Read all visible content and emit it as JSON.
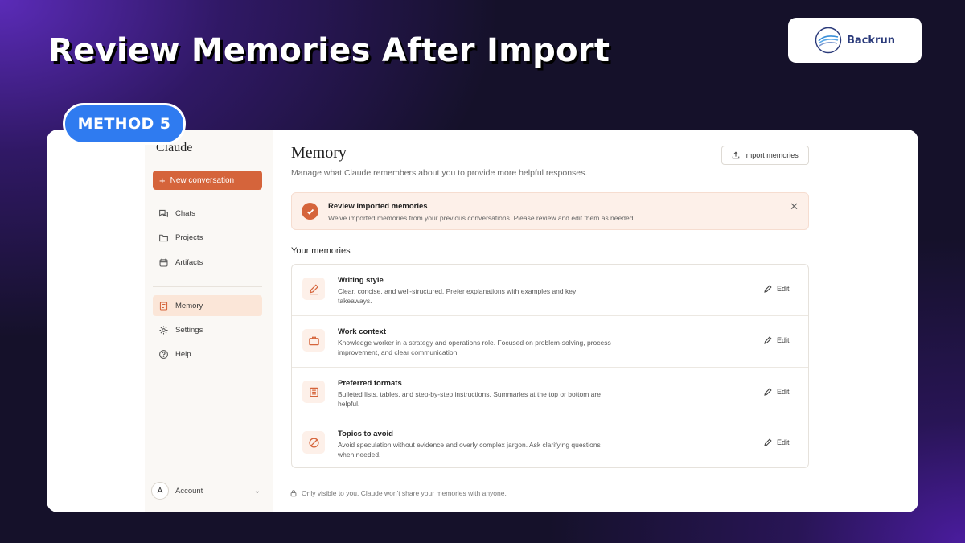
{
  "headline": "Review Memories After Import",
  "logo": {
    "text": "Backrun"
  },
  "badge": "METHOD 5",
  "sidebar": {
    "brand": "Claude",
    "new_conversation": "New conversation",
    "items": [
      {
        "label": "Chats",
        "icon": "chat-icon"
      },
      {
        "label": "Projects",
        "icon": "folder-icon"
      },
      {
        "label": "Artifacts",
        "icon": "artifact-icon"
      },
      {
        "label": "Memory",
        "icon": "memory-icon",
        "active": true
      },
      {
        "label": "Settings",
        "icon": "gear-icon"
      },
      {
        "label": "Help",
        "icon": "help-icon"
      }
    ],
    "account": {
      "avatar": "A",
      "label": "Account"
    }
  },
  "main": {
    "title": "Memory",
    "subtitle": "Manage what Claude remembers about you to provide more helpful responses.",
    "import_button": "Import memories",
    "notice": {
      "title": "Review imported memories",
      "body": "We've imported memories from your previous conversations. Please review and edit them as needed."
    },
    "section_title": "Your memories",
    "memories": [
      {
        "title": "Writing style",
        "description": "Clear, concise, and well-structured. Prefer explanations with examples and key takeaways.",
        "icon": "pen-icon",
        "edit": "Edit"
      },
      {
        "title": "Work context",
        "description": "Knowledge worker in a strategy and operations role. Focused on problem-solving, process improvement, and clear communication.",
        "icon": "briefcase-icon",
        "edit": "Edit"
      },
      {
        "title": "Preferred formats",
        "description": "Bulleted lists, tables, and step-by-step instructions. Summaries at the top or bottom are helpful.",
        "icon": "document-icon",
        "edit": "Edit"
      },
      {
        "title": "Topics to avoid",
        "description": "Avoid speculation without evidence and overly complex jargon. Ask clarifying questions when needed.",
        "icon": "prohibited-icon",
        "edit": "Edit"
      }
    ],
    "privacy_note": "Only visible to you. Claude won't share your memories with anyone."
  },
  "colors": {
    "accent": "#d5643b",
    "badge": "#2f7bf0",
    "background": "#15112a"
  }
}
